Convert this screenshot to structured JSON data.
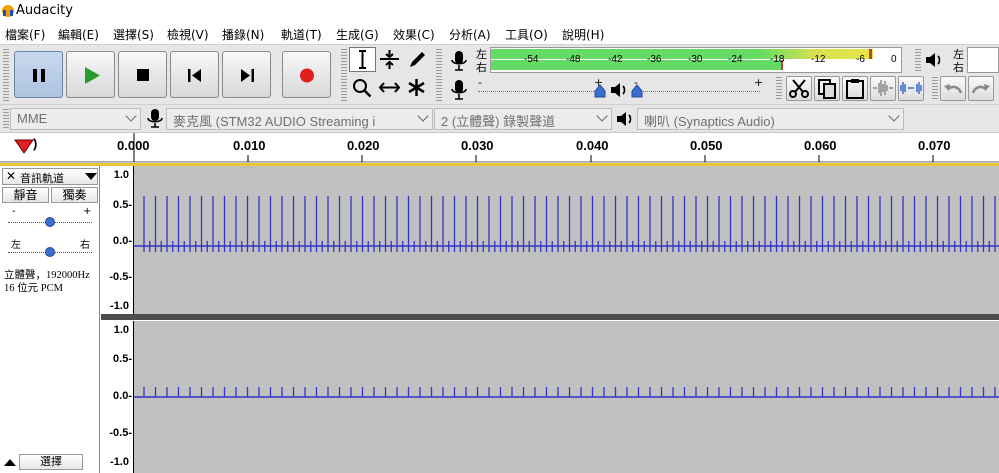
{
  "window": {
    "title": "Audacity"
  },
  "menu": [
    "檔案(F)",
    "編輯(E)",
    "選擇(S)",
    "檢視(V)",
    "播錄(N)",
    "軌道(T)",
    "生成(G)",
    "效果(C)",
    "分析(A)",
    "工具(O)",
    "說明(H)"
  ],
  "transport": {
    "pause": "pause-icon",
    "play": "play-icon",
    "stop": "stop-icon",
    "skip_start": "skip-start-icon",
    "skip_end": "skip-end-icon",
    "record": "record-icon"
  },
  "meter": {
    "lr_top": "左",
    "lr_bottom": "右",
    "scale": [
      "-54",
      "-48",
      "-42",
      "-36",
      "-30",
      "-24",
      "-18",
      "-12",
      "-6",
      "0"
    ],
    "playback_lr_top": "左",
    "playback_lr_bottom": "右"
  },
  "mixer": {
    "minus": "-",
    "plus": "+"
  },
  "devices": {
    "host": "MME",
    "input": "麥克風 (STM32 AUDIO Streaming i",
    "channels": "2 (立體聲) 錄製聲道",
    "output": "喇叭 (Synaptics Audio)"
  },
  "ruler": {
    "ticks": [
      "0.000",
      "0.010",
      "0.020",
      "0.030",
      "0.040",
      "0.050",
      "0.060",
      "0.070"
    ],
    "left_label": ")"
  },
  "track": {
    "name": "音訊軌道",
    "mute": "靜音",
    "solo": "獨奏",
    "gain_minus": "-",
    "gain_plus": "+",
    "pan_left": "左",
    "pan_right": "右",
    "info_line1": "立體聲，192000Hz",
    "info_line2": "16 位元 PCM",
    "select": "選擇"
  },
  "vruler": [
    "1.0",
    "0.5-",
    "0.0-",
    "-0.5-",
    "-1.0"
  ],
  "colors": {
    "wave": "#3232c8",
    "meter_green": "#64dc64",
    "meter_yellow": "#dcdc32",
    "record": "#e02020",
    "play": "#2a9a2a"
  }
}
